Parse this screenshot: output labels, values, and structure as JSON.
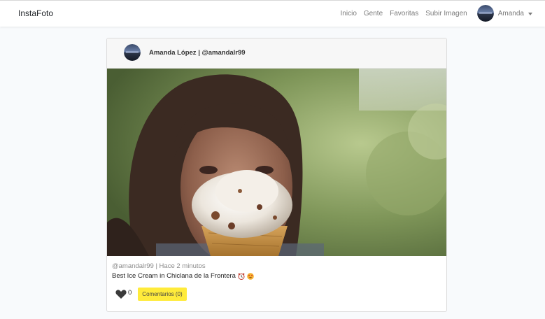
{
  "navbar": {
    "brand": "InstaFoto",
    "links": [
      "Inicio",
      "Gente",
      "Favoritas",
      "Subir Imagen"
    ],
    "user_name": "Amanda"
  },
  "post": {
    "author": "Amanda López | @amandalr99",
    "meta": "@amandalr99 | Hace 2 minutos",
    "description": "Best Ice Cream in Chiclana de la Frontera",
    "likes": "0",
    "comments_button": "Comentarios (0)"
  },
  "colors": {
    "accent_yellow": "#ffeb3b",
    "navbar_bg": "#ffffff",
    "page_bg": "#f8fafc"
  },
  "icons": {
    "like": "heart-icon",
    "dropdown": "caret-down-icon",
    "emoji_1": "alarm-clock-emoji",
    "emoji_2": "heart-eyes-emoji"
  }
}
